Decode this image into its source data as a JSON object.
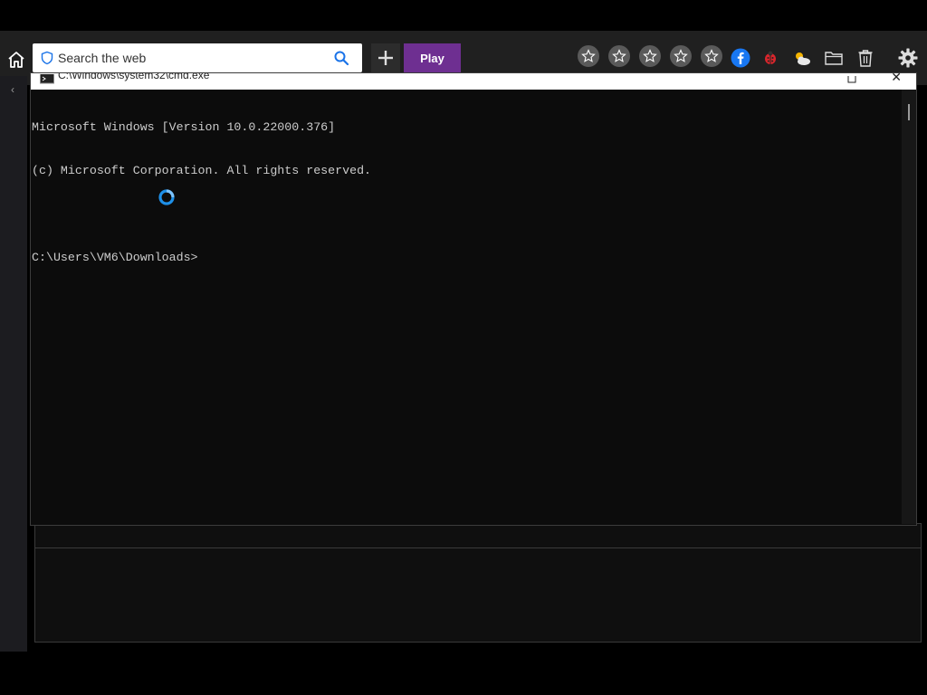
{
  "browser": {
    "search": {
      "placeholder": "Search the web"
    },
    "play_label": "Play",
    "favorites": [
      {
        "icon": "star-icon"
      },
      {
        "icon": "star-icon"
      },
      {
        "icon": "star-icon"
      },
      {
        "icon": "star-icon"
      },
      {
        "icon": "star-icon"
      }
    ],
    "toolbar_icons": [
      "facebook-icon",
      "ladybug-icon",
      "weather-icon",
      "folder-icon",
      "trash-icon",
      "gear-icon"
    ],
    "accent": "#6e2f91"
  },
  "cmd": {
    "title": "C:\\Windows\\system32\\cmd.exe",
    "lines": [
      "Microsoft Windows [Version 10.0.22000.376]",
      "(c) Microsoft Corporation. All rights reserved.",
      "",
      "C:\\Users\\VM6\\Downloads>"
    ],
    "text_color": "#cccccc",
    "background": "#0c0c0c"
  },
  "cursor": {
    "state": "busy-spinner",
    "color": "#1e90e8"
  }
}
